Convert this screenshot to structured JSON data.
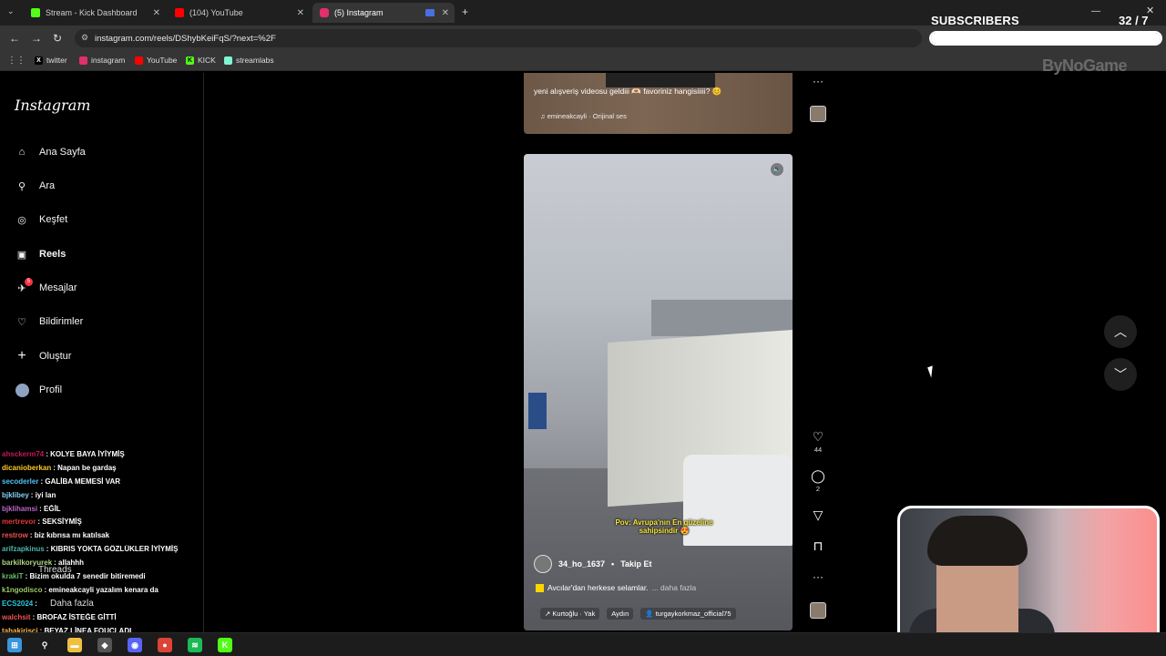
{
  "browser": {
    "tabs": [
      {
        "title": "Stream - Kick Dashboard",
        "fav_color": "#53fc18",
        "fav_letter": "K"
      },
      {
        "title": "(104) YouTube",
        "fav_color": "#ff0000",
        "fav_letter": "▶"
      },
      {
        "title": "(5) Instagram",
        "fav_color": "#e1306c",
        "fav_letter": "◎"
      }
    ],
    "url": "instagram.com/reels/DShybKeiFqS/?next=%2F",
    "bookmarks": [
      {
        "label": "twitter",
        "color": "#000000",
        "letter": "X"
      },
      {
        "label": "instagram",
        "color": "#e1306c",
        "letter": "◎"
      },
      {
        "label": "YouTube",
        "color": "#ff0000",
        "letter": "▶"
      },
      {
        "label": "KICK",
        "color": "#53fc18",
        "letter": "K"
      },
      {
        "label": "streamlabs",
        "color": "#80f5d2",
        "letter": "S"
      }
    ]
  },
  "overlay": {
    "subs_title": "SUBSCRIBERS",
    "subs_count": "32 / 7",
    "subs_progress": 1.0,
    "brand": "ByNoGame"
  },
  "sidebar": {
    "logo": "Instagram",
    "items": [
      {
        "label": "Ana Sayfa",
        "icon": "home-icon",
        "glyph": "⌂"
      },
      {
        "label": "Ara",
        "icon": "search-icon",
        "glyph": "⚲"
      },
      {
        "label": "Keşfet",
        "icon": "explore-icon",
        "glyph": "◎"
      },
      {
        "label": "Reels",
        "icon": "reels-icon",
        "glyph": "▣"
      },
      {
        "label": "Mesajlar",
        "icon": "messages-icon",
        "glyph": "✈"
      },
      {
        "label": "Bildirimler",
        "icon": "heart-icon",
        "glyph": "♡"
      },
      {
        "label": "Oluştur",
        "icon": "plus-icon",
        "glyph": "+"
      },
      {
        "label": "Profil",
        "icon": "avatar-icon",
        "glyph": "●"
      }
    ],
    "messages_badge": "5",
    "threads": "Threads",
    "more": "Daha fazla"
  },
  "prev_reel": {
    "caption": "yeni alışveriş videosu geldiii 🫶🏻 favoriniz hangisiiiii? 😊",
    "audio": "emineakcayli · Orijinal ses"
  },
  "reel": {
    "username": "34_ho_1637",
    "follow": "Takip Et",
    "caption": "Avcılar'dan herkese selamlar.",
    "more": "... daha fazla",
    "overlay_text": "Pov: Avrupa'nın En güzeline sahipsindir 😍",
    "tags": [
      "Kurtoğlu · Yak",
      "Aydın",
      "turgaykorkmaz_official75"
    ],
    "likes": "44",
    "comments": "2"
  },
  "chat": [
    {
      "user": "ahsckerm74",
      "color": "#c2185b",
      "msg": "KOLYE BAYA İYİYMİŞ"
    },
    {
      "user": "dicanioberkan",
      "color": "#ffca28",
      "msg": "Napan be gardaş"
    },
    {
      "user": "secoderler",
      "color": "#4fc3f7",
      "msg": "GALİBA MEMESİ VAR"
    },
    {
      "user": "bjklibey",
      "color": "#81d4fa",
      "msg": "iyi lan"
    },
    {
      "user": "bjklihamsi",
      "color": "#ba68c8",
      "msg": "EĞİL"
    },
    {
      "user": "mertrevor",
      "color": "#e53935",
      "msg": "SEKSİYMİŞ"
    },
    {
      "user": "restrow",
      "color": "#ef5350",
      "msg": "biz kıbrısa mı katılsak"
    },
    {
      "user": "arifzapkinus",
      "color": "#4db6ac",
      "msg": "KIBRIS YOKTA GÖZLÜKLER İYİYMİŞ"
    },
    {
      "user": "barkilkoryurek",
      "color": "#aed581",
      "msg": "allahhh"
    },
    {
      "user": "krakiT",
      "color": "#66bb6a",
      "msg": "Bizim okulda 7 senedir bitiremedi"
    },
    {
      "user": "k1ngodisco",
      "color": "#9ccc65",
      "msg": "emineakcayli yazalım kenara da"
    },
    {
      "user": "ECS2024",
      "color": "#26c6da",
      "msg": ""
    },
    {
      "user": "walchsit",
      "color": "#ef5350",
      "msg": "BROFAZ İSTEĞE GİTTİ"
    },
    {
      "user": "tahakirisci",
      "color": "#ffb74d",
      "msg": "BEYAZ LİNEA FOUCLADI"
    }
  ],
  "taskbar": [
    {
      "name": "windows-start-icon",
      "color": "#3a96dd",
      "glyph": "⊞"
    },
    {
      "name": "search-icon",
      "color": "#1c1c1c",
      "glyph": "⚲"
    },
    {
      "name": "file-explorer-icon",
      "color": "#f0c040",
      "glyph": "▬"
    },
    {
      "name": "app-icon",
      "color": "#555",
      "glyph": "◆"
    },
    {
      "name": "discord-icon",
      "color": "#5865f2",
      "glyph": "◉"
    },
    {
      "name": "chrome-icon",
      "color": "#db4437",
      "glyph": "●"
    },
    {
      "name": "spotify-icon",
      "color": "#1db954",
      "glyph": "≋"
    },
    {
      "name": "kick-app-icon",
      "color": "#53fc18",
      "glyph": "K"
    }
  ]
}
